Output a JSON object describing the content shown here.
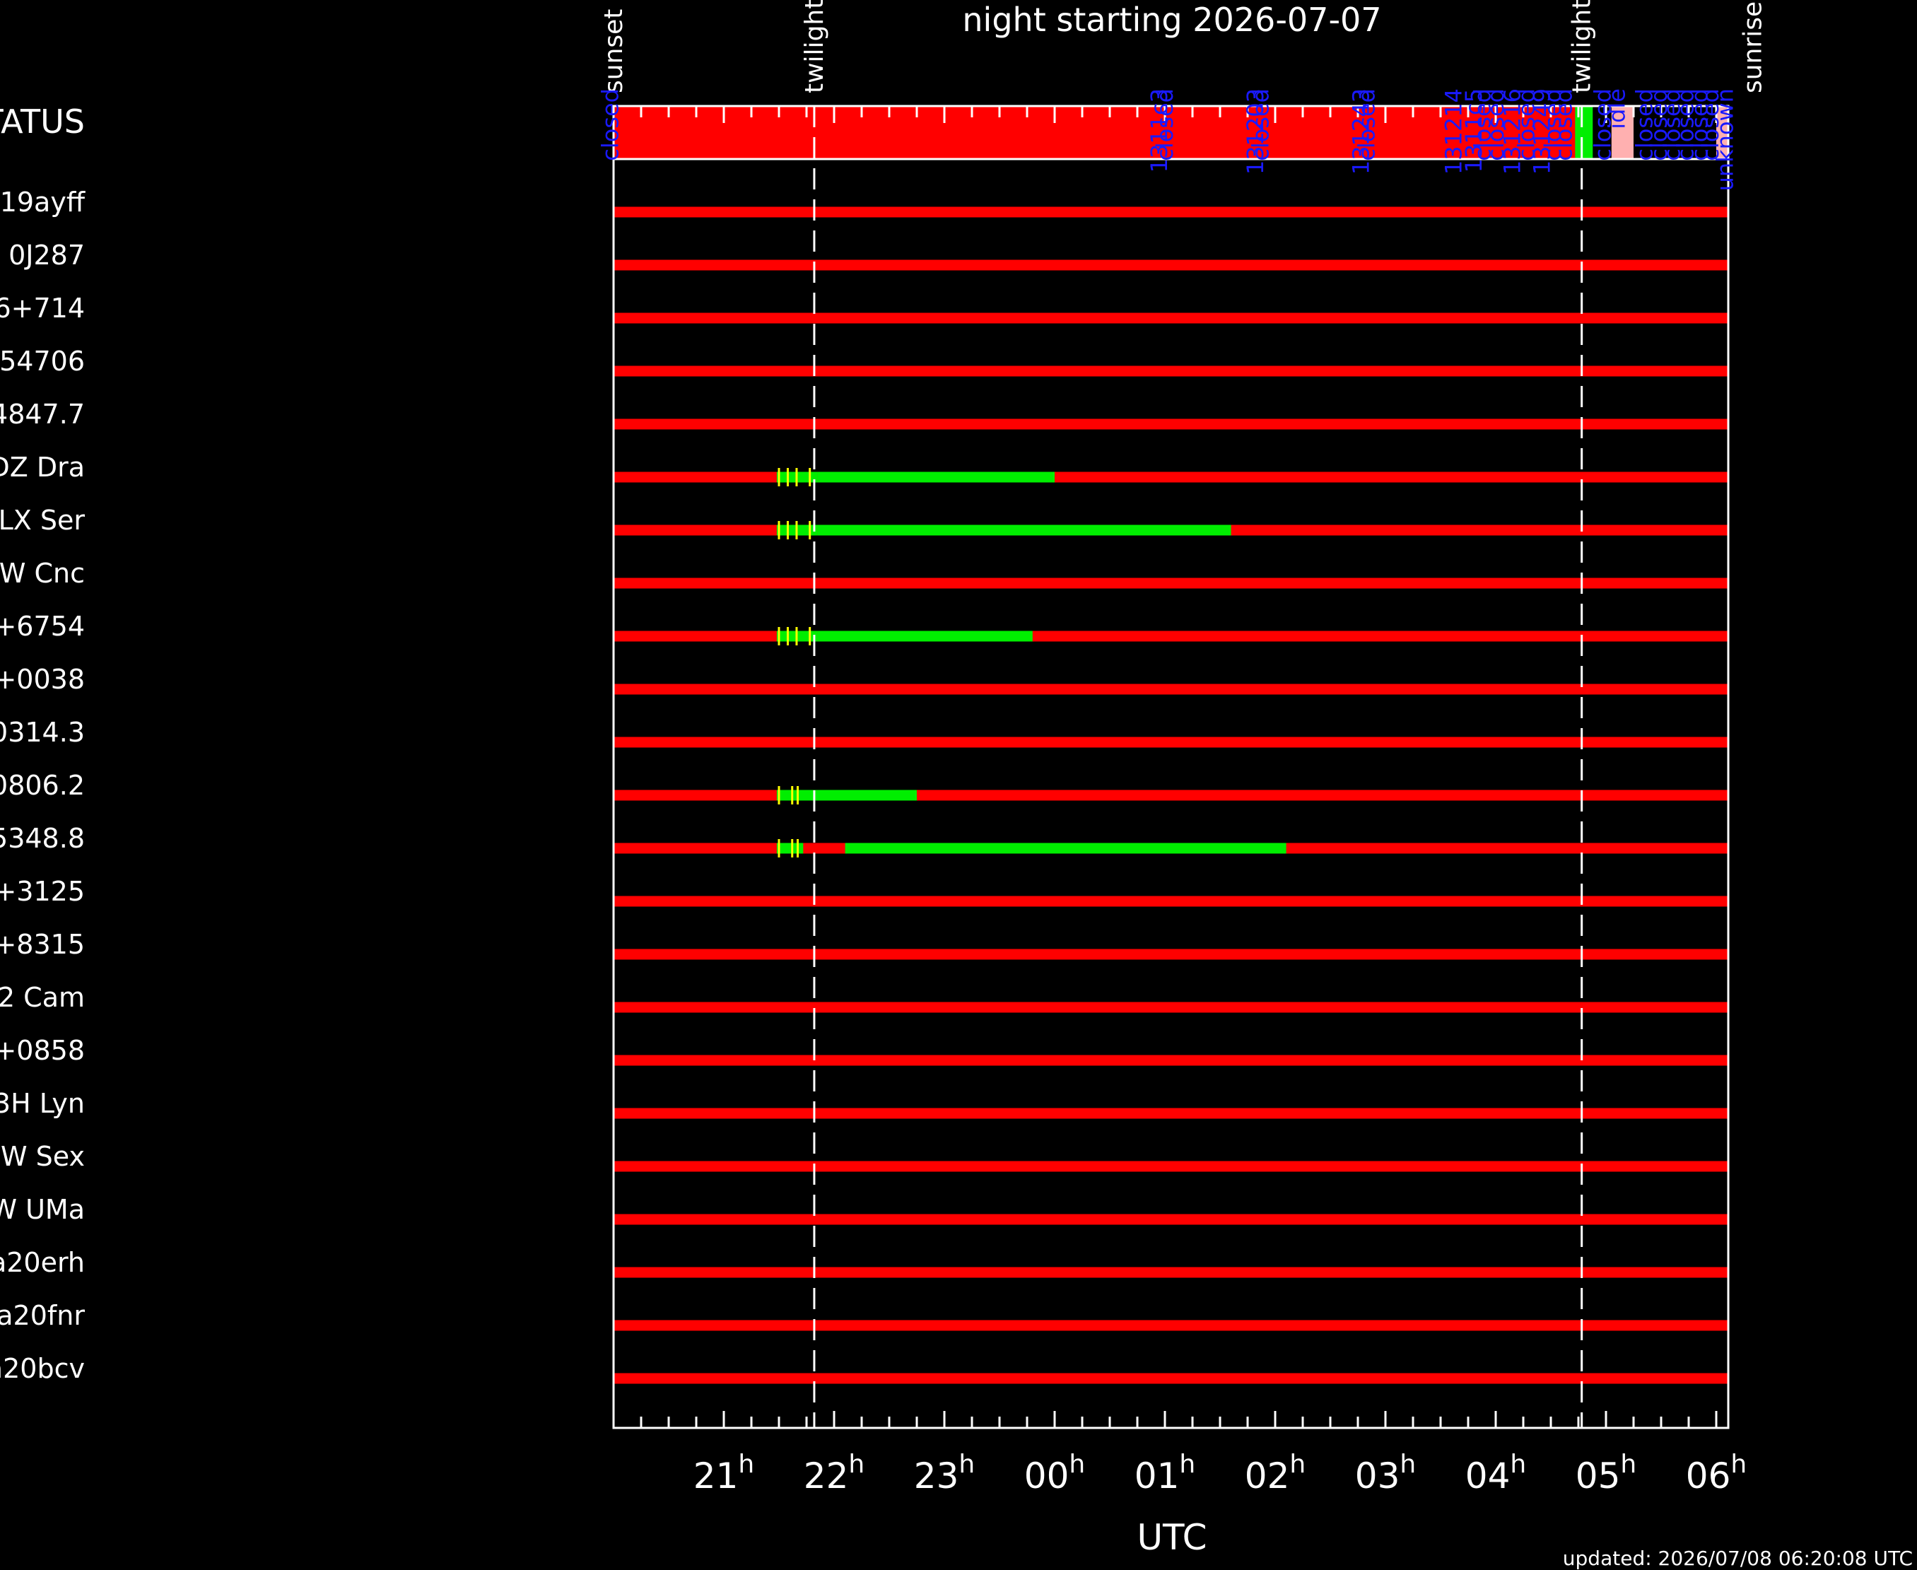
{
  "chart_data": {
    "type": "timeline",
    "title": "night starting 2026-07-07",
    "xlabel": "UTC",
    "updated": "updated: 2026/07/08 06:20:08 UTC",
    "x_range_hours": [
      20.25,
      26.5
    ],
    "tick_labels": [
      {
        "hour": 21,
        "main": "21",
        "sup": "h"
      },
      {
        "hour": 22,
        "main": "22",
        "sup": "h"
      },
      {
        "hour": 23,
        "main": "23",
        "sup": "h"
      },
      {
        "hour": 24,
        "main": "00",
        "sup": "h"
      },
      {
        "hour": 25,
        "main": "01",
        "sup": "h"
      },
      {
        "hour": 26,
        "main": "02",
        "sup": "h"
      },
      {
        "hour": 27,
        "main": "03",
        "sup": "h"
      },
      {
        "hour": 28,
        "main": "04",
        "sup": "h"
      },
      {
        "hour": 29,
        "main": "05",
        "sup": "h"
      },
      {
        "hour": 30,
        "main": "06",
        "sup": "h"
      }
    ],
    "events": [
      {
        "label": "sunset",
        "hour": 20.0,
        "dashed": false
      },
      {
        "label": "twilight",
        "hour": 21.82,
        "dashed": true
      },
      {
        "label": "twilight",
        "hour": 28.78,
        "dashed": true
      },
      {
        "label": "sunrise",
        "hour": 30.33,
        "dashed": false
      }
    ],
    "status_row": {
      "label": "STATUS",
      "segments": [
        {
          "start": 20.0,
          "end": 28.81,
          "color": "#ff0000"
        },
        {
          "start": 28.72,
          "end": 28.88,
          "color": "#00ee00"
        },
        {
          "start": 29.05,
          "end": 29.25,
          "color": "#ffb0b0"
        },
        {
          "start": 30.0,
          "end": 30.15,
          "color": "#ffb0b0"
        }
      ],
      "annotations": [
        {
          "text": "closed",
          "hour": 19.97
        },
        {
          "text": "1311c3",
          "hour": 24.95
        },
        {
          "text": "closed",
          "hour": 25.0
        },
        {
          "text": "131203",
          "hour": 25.82
        },
        {
          "text": "closed",
          "hour": 25.87
        },
        {
          "text": "131243",
          "hour": 26.78
        },
        {
          "text": "closed",
          "hour": 26.83
        },
        {
          "text": "131214",
          "hour": 27.62
        },
        {
          "text": "1311c5",
          "hour": 27.8
        },
        {
          "text": "closed",
          "hour": 27.88
        },
        {
          "text": "closed",
          "hour": 28.0
        },
        {
          "text": "131216",
          "hour": 28.15
        },
        {
          "text": "closed",
          "hour": 28.28
        },
        {
          "text": "131249",
          "hour": 28.42
        },
        {
          "text": "closed",
          "hour": 28.52
        },
        {
          "text": "closed",
          "hour": 28.62
        },
        {
          "text": "closed",
          "hour": 28.97
        },
        {
          "text": "idle",
          "hour": 29.1
        },
        {
          "text": "closed",
          "hour": 29.35
        },
        {
          "text": "closed",
          "hour": 29.48
        },
        {
          "text": "closed",
          "hour": 29.6
        },
        {
          "text": "closed",
          "hour": 29.72
        },
        {
          "text": "closed",
          "hour": 29.85
        },
        {
          "text": "closed",
          "hour": 29.95
        },
        {
          "text": "unknown",
          "hour": 30.08
        }
      ]
    },
    "targets": [
      {
        "name": "19ayff",
        "green": [],
        "ticks": []
      },
      {
        "name": "0J287",
        "green": [],
        "ticks": []
      },
      {
        "name": "6+714",
        "green": [],
        "ticks": []
      },
      {
        "name": "54706",
        "green": [],
        "ticks": []
      },
      {
        "name": "4847.7",
        "green": [],
        "ticks": []
      },
      {
        "name": "DZ Dra",
        "green": [
          [
            21.48,
            21.85
          ],
          [
            21.85,
            24.0
          ]
        ],
        "ticks": [
          21.5,
          21.58,
          21.66,
          21.78
        ]
      },
      {
        "name": "LX Ser",
        "green": [
          [
            21.48,
            21.85
          ],
          [
            21.85,
            25.6
          ]
        ],
        "ticks": [
          21.5,
          21.58,
          21.66,
          21.78
        ]
      },
      {
        "name": "W Cnc",
        "green": [],
        "ticks": []
      },
      {
        "name": "+6754",
        "green": [
          [
            21.48,
            21.85
          ],
          [
            21.85,
            23.8
          ]
        ],
        "ticks": [
          21.5,
          21.58,
          21.66,
          21.78
        ]
      },
      {
        "name": "+0038",
        "green": [],
        "ticks": []
      },
      {
        "name": "0314.3",
        "green": [],
        "ticks": []
      },
      {
        "name": "0806.2",
        "green": [
          [
            21.48,
            22.75
          ]
        ],
        "ticks": [
          21.5,
          21.62,
          21.67
        ]
      },
      {
        "name": "5348.8",
        "green": [
          [
            21.48,
            21.72
          ],
          [
            22.1,
            26.1
          ]
        ],
        "ticks": [
          21.5,
          21.62,
          21.67
        ]
      },
      {
        "name": "+3125",
        "green": [],
        "ticks": []
      },
      {
        "name": "+8315",
        "green": [],
        "ticks": []
      },
      {
        "name": "2 Cam",
        "green": [],
        "ticks": []
      },
      {
        "name": "+0858",
        "green": [],
        "ticks": []
      },
      {
        "name": "3H Lyn",
        "green": [],
        "ticks": []
      },
      {
        "name": "SW Sex",
        "green": [],
        "ticks": []
      },
      {
        "name": "W UMa",
        "green": [],
        "ticks": []
      },
      {
        "name": "a20erh",
        "green": [],
        "ticks": []
      },
      {
        "name": "a20fnr",
        "green": [],
        "ticks": []
      },
      {
        "name": "a20bcv",
        "green": [],
        "ticks": []
      }
    ],
    "colors": {
      "unobservable": "#ff0000",
      "observable": "#00ee00",
      "marker": "#ffff00",
      "annotation": "#1a1aff",
      "frame": "#ffffff",
      "background": "#000000"
    }
  }
}
